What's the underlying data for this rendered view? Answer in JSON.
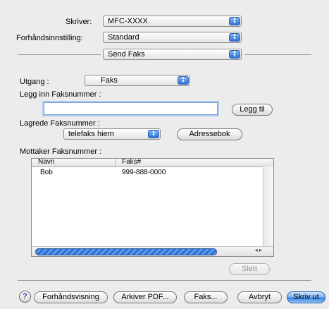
{
  "printer": {
    "label": "Skriver:",
    "value": "MFC-XXXX"
  },
  "preset": {
    "label": "Forhåndsinnstilling:",
    "value": "Standard"
  },
  "panel": {
    "value": "Send Faks"
  },
  "output": {
    "label": "Utgang :",
    "value": "Faks"
  },
  "enter_number": {
    "label": "Legg inn Faksnummer :",
    "value": "",
    "add_button": "Legg til"
  },
  "saved_numbers": {
    "label": "Lagrede Faksnummer :",
    "value": "telefaks hiem",
    "addressbook_button": "Adressebok"
  },
  "recipients": {
    "label": "Mottaker Faksnummer :",
    "columns": [
      "Navn",
      "Faks#"
    ],
    "rows": [
      {
        "name": "Bob",
        "fax": "999-888-0000"
      }
    ],
    "delete_button": "Slett",
    "scroll_arrows": "◂ ▸"
  },
  "footer": {
    "help": "?",
    "preview": "Forhåndsvisning",
    "save_pdf": "Arkiver PDF...",
    "fax": "Faks...",
    "cancel": "Avbryt",
    "print": "Skriv ut"
  },
  "icons": {
    "popup_arrows": "updown-arrows-icon"
  },
  "colors": {
    "accent": "#3d85df",
    "background": "#ececec"
  }
}
